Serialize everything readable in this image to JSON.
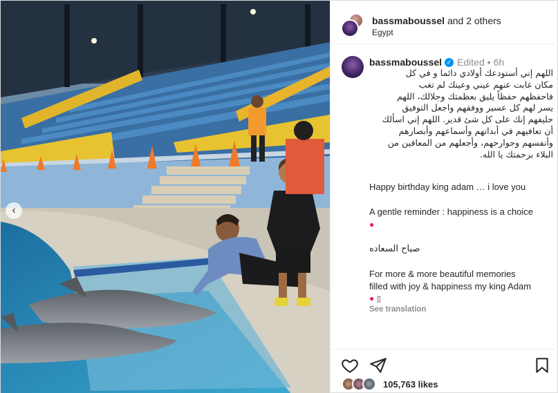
{
  "header": {
    "username": "bassmaboussel",
    "others": "and 2 others",
    "location": "Egypt"
  },
  "caption": {
    "username": "bassmaboussel",
    "edited": "Edited",
    "dot": "•",
    "time": "6h",
    "arabic_lines": [
      "اللهم إني أستودعك أولادي دائما و في كل",
      "مكان غابت عنهم عيني وعينك لم تغب",
      "فاحفظهم حفظاً يليق بعظمتك وجلالك، اللهم",
      "يسر لهم كل عسير ووفقهم واجعل التوفيق",
      "حليفهم إنك على كل شئ قدير. اللهم إني اسألك",
      "أن تعافيهم في أبدانهم وأسماعهم وأبصارهم",
      "وأنفسهم وجوارحهم، وأجعلهم من المعافين من",
      "البلاء برحمتك يا الله."
    ],
    "birthday_line": "Happy birthday king adam … i love you",
    "reminder_line": "A gentle reminder : happiness is a choice",
    "morning_line": "صباح السعاده",
    "more_line_1": "For more & more beautiful memories",
    "more_line_2": "filled with joy & happiness my king Adam",
    "see_translation": "See translation"
  },
  "footer": {
    "likes_count": "105,763 likes"
  },
  "icons": {
    "like": "heart-icon",
    "share": "paper-plane-icon",
    "save": "bookmark-icon",
    "prev": "chevron-left-icon",
    "verified": "verified-badge-icon"
  },
  "colors": {
    "verified_blue": "#0095f6",
    "muted_text": "#8e8e8e",
    "text": "#262626"
  }
}
